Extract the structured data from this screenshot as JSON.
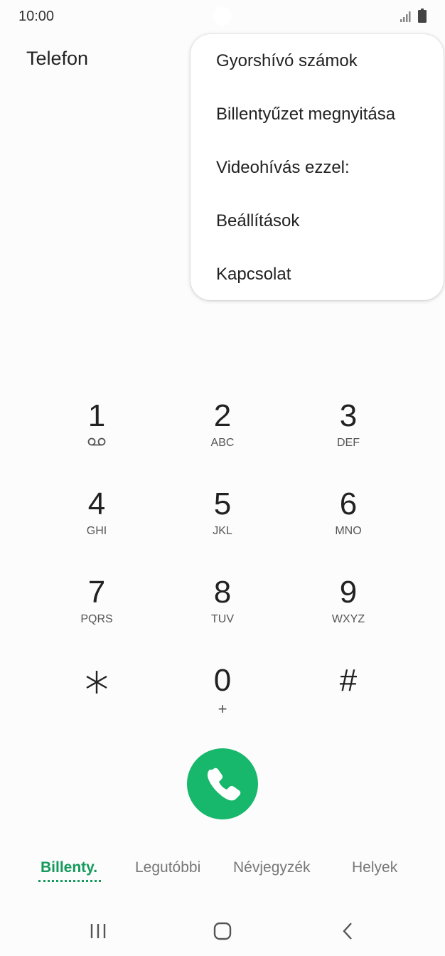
{
  "status_bar": {
    "time": "10:00",
    "icons": [
      "signal-icon",
      "battery-icon"
    ]
  },
  "app": {
    "title": "Telefon"
  },
  "menu": {
    "items": [
      "Gyorshívó számok",
      "Billentyűzet megnyitása",
      "Videohívás ezzel:",
      "Beállítások",
      "Kapcsolat"
    ]
  },
  "keypad": {
    "keys": [
      {
        "digit": "1",
        "letters": "",
        "icon": "voicemail-icon"
      },
      {
        "digit": "2",
        "letters": "ABC"
      },
      {
        "digit": "3",
        "letters": "DEF"
      },
      {
        "digit": "4",
        "letters": "GHI"
      },
      {
        "digit": "5",
        "letters": "JKL"
      },
      {
        "digit": "6",
        "letters": "MNO"
      },
      {
        "digit": "7",
        "letters": "PQRS"
      },
      {
        "digit": "8",
        "letters": "TUV"
      },
      {
        "digit": "9",
        "letters": "WXYZ"
      },
      {
        "digit": "*",
        "letters": ""
      },
      {
        "digit": "0",
        "letters": "+"
      },
      {
        "digit": "#",
        "letters": ""
      }
    ]
  },
  "call": {
    "icon": "phone-icon",
    "color": "#17b86c"
  },
  "tabs": {
    "items": [
      "Billenty.",
      "Legutóbbi",
      "Névjegyzék",
      "Helyek"
    ],
    "active": "Billenty.",
    "active_color": "#149a5a"
  },
  "nav": {
    "icons": [
      "recent-apps-icon",
      "home-icon",
      "back-icon"
    ]
  }
}
